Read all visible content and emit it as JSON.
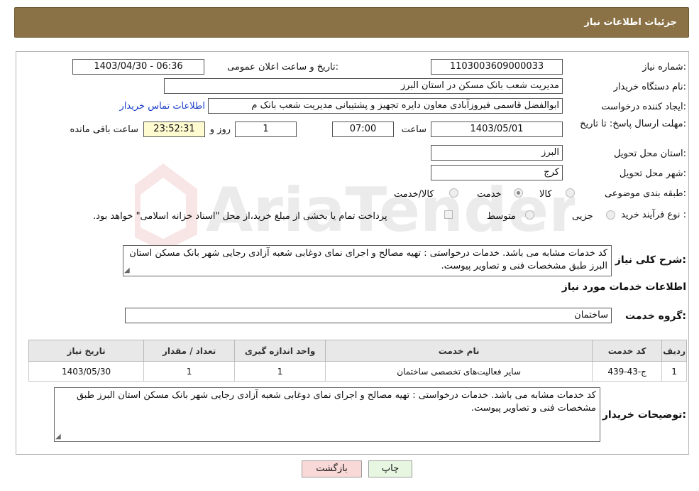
{
  "header": {
    "title": "جزئیات اطلاعات نیاز"
  },
  "form": {
    "need_number_label": "شماره نیاز:",
    "need_number": "1103003609000033",
    "announce_label": "تاریخ و ساعت اعلان عمومی:",
    "announce_value": "1403/04/30 - 06:36",
    "buyer_label": "نام دستگاه خریدار:",
    "buyer_value": "مدیریت شعب بانک مسکن در استان البرز",
    "creator_label": "ایجاد کننده درخواست:",
    "creator_value": "ابوالفضل قاسمی فیروزآبادی معاون دایره تجهیز و پشتیبانی مدیریت شعب بانک م",
    "contact_link": "اطلاعات تماس خریدار",
    "deadline_label": "مهلت ارسال پاسخ: تا تاریخ:",
    "deadline_date": "1403/05/01",
    "time_label": "ساعت",
    "deadline_time": "07:00",
    "days_value": "1",
    "days_label": "روز و",
    "remaining_time": "23:52:31",
    "remaining_label": "ساعت باقی مانده",
    "province_label": "استان محل تحویل:",
    "province_value": "البرز",
    "city_label": "شهر محل تحویل:",
    "city_value": "کرج",
    "category_label": "طبقه بندی موضوعی:",
    "category_options": [
      "کالا",
      "خدمت",
      "کالا/خدمت"
    ],
    "category_selected": "خدمت",
    "purchase_label": "نوع فرآیند خرید :",
    "purchase_options": [
      "جزیی",
      "متوسط"
    ],
    "payment_note": "پرداخت تمام یا بخشی از مبلغ خرید،از محل \"اسناد خزانه اسلامی\" خواهد بود."
  },
  "description": {
    "label": "شرح کلی نیاز:",
    "text": "کد خدمات مشابه می باشد. خدمات درخواستی : تهیه مصالح و اجرای نمای دوغابی شعبه آزادی رجایی شهر بانک مسکن استان البرز طبق مشخصات فنی و تصاویر پیوست."
  },
  "services": {
    "section_title": "اطلاعات خدمات مورد نیاز",
    "group_label": "گروه خدمت:",
    "group_value": "ساختمان",
    "columns": [
      "ردیف",
      "کد خدمت",
      "نام خدمت",
      "واحد اندازه گیری",
      "تعداد / مقدار",
      "تاریخ نیاز"
    ],
    "rows": [
      [
        "1",
        "ج-43-439",
        "سایر فعالیت‌های تخصصی ساختمان",
        "1",
        "1",
        "1403/05/30"
      ]
    ]
  },
  "buyer_notes": {
    "label": "توضیحات خریدار:",
    "text": "کد خدمات مشابه می باشد. خدمات درخواستی : تهیه مصالح و اجرای نمای دوغابی شعبه آزادی رجایی شهر بانک مسکن استان البرز طبق مشخصات فنی و تصاویر پیوست."
  },
  "buttons": {
    "print": "چاپ",
    "back": "بازگشت"
  },
  "watermark_text": "AriaTender.neT",
  "colors": {
    "header_bg": "#8b7246",
    "link": "#1a3fc9",
    "back_btn": "#f9d8d8",
    "print_btn": "#e6f6e0"
  }
}
